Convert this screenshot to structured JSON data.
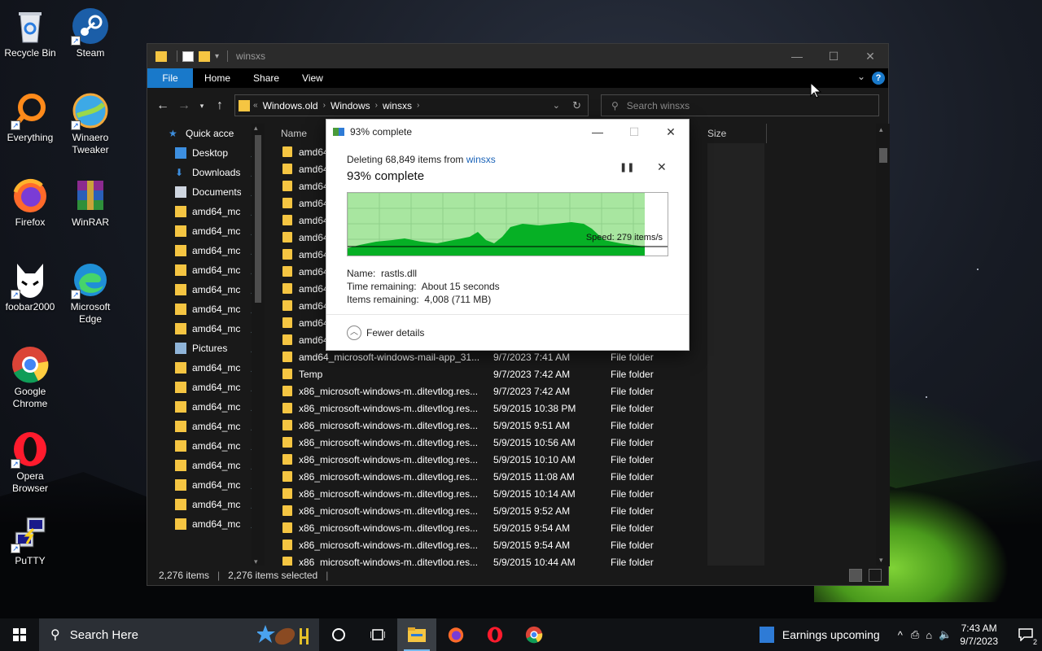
{
  "desktop": {
    "icons": [
      {
        "label": "Recycle Bin"
      },
      {
        "label": "Steam"
      },
      {
        "label": "Everything"
      },
      {
        "label": "Winaero Tweaker"
      },
      {
        "label": "Firefox"
      },
      {
        "label": "WinRAR"
      },
      {
        "label": "foobar2000"
      },
      {
        "label": "Microsoft Edge"
      },
      {
        "label": "Google Chrome"
      },
      {
        "label": "Opera Browser"
      },
      {
        "label": "PuTTY"
      }
    ]
  },
  "explorer": {
    "title": "winsxs",
    "ribbon_tabs": [
      "File",
      "Home",
      "Share",
      "View"
    ],
    "address": {
      "crumbs": [
        "Windows.old",
        "Windows",
        "winsxs"
      ]
    },
    "search_placeholder": "Search winsxs",
    "columns": {
      "name": "Name",
      "size": "Size"
    },
    "nav_items": [
      {
        "label": "Quick access",
        "pinned": false
      },
      {
        "label": "Desktop",
        "pinned": true
      },
      {
        "label": "Downloads",
        "pinned": true
      },
      {
        "label": "Documents",
        "pinned": true
      },
      {
        "label": "amd64_mc",
        "pinned": true
      },
      {
        "label": "amd64_mc",
        "pinned": true
      },
      {
        "label": "amd64_mc",
        "pinned": true
      },
      {
        "label": "amd64_mc",
        "pinned": true
      },
      {
        "label": "amd64_mc",
        "pinned": true
      },
      {
        "label": "amd64_mc",
        "pinned": true
      },
      {
        "label": "amd64_mc",
        "pinned": true
      },
      {
        "label": "Pictures",
        "pinned": true
      },
      {
        "label": "amd64_mc",
        "pinned": true
      },
      {
        "label": "amd64_mc",
        "pinned": true
      },
      {
        "label": "amd64_mc",
        "pinned": true
      },
      {
        "label": "amd64_mc",
        "pinned": true
      },
      {
        "label": "amd64_mc",
        "pinned": true
      },
      {
        "label": "amd64_mc",
        "pinned": true
      },
      {
        "label": "amd64_mc",
        "pinned": true
      },
      {
        "label": "amd64_mc",
        "pinned": true
      },
      {
        "label": "amd64_mc",
        "pinned": true
      }
    ],
    "rows": [
      {
        "name": "amd64",
        "date": "",
        "type": ""
      },
      {
        "name": "amd64",
        "date": "",
        "type": ""
      },
      {
        "name": "amd64",
        "date": "",
        "type": ""
      },
      {
        "name": "amd64",
        "date": "",
        "type": ""
      },
      {
        "name": "amd64",
        "date": "",
        "type": ""
      },
      {
        "name": "amd64",
        "date": "",
        "type": ""
      },
      {
        "name": "amd64",
        "date": "",
        "type": ""
      },
      {
        "name": "amd64",
        "date": "",
        "type": ""
      },
      {
        "name": "amd64",
        "date": "",
        "type": ""
      },
      {
        "name": "amd64",
        "date": "",
        "type": ""
      },
      {
        "name": "amd64",
        "date": "",
        "type": ""
      },
      {
        "name": "amd64",
        "date": "",
        "type": ""
      },
      {
        "name": "amd64_microsoft-windows-mail-app_31...",
        "date": "9/7/2023 7:41 AM",
        "type": "File folder"
      },
      {
        "name": "Temp",
        "date": "9/7/2023 7:42 AM",
        "type": "File folder"
      },
      {
        "name": "x86_microsoft-windows-m..ditevtlog.res...",
        "date": "9/7/2023 7:42 AM",
        "type": "File folder"
      },
      {
        "name": "x86_microsoft-windows-m..ditevtlog.res...",
        "date": "5/9/2015 10:38 PM",
        "type": "File folder"
      },
      {
        "name": "x86_microsoft-windows-m..ditevtlog.res...",
        "date": "5/9/2015 9:51 AM",
        "type": "File folder"
      },
      {
        "name": "x86_microsoft-windows-m..ditevtlog.res...",
        "date": "5/9/2015 10:56 AM",
        "type": "File folder"
      },
      {
        "name": "x86_microsoft-windows-m..ditevtlog.res...",
        "date": "5/9/2015 10:10 AM",
        "type": "File folder"
      },
      {
        "name": "x86_microsoft-windows-m..ditevtlog.res...",
        "date": "5/9/2015 11:08 AM",
        "type": "File folder"
      },
      {
        "name": "x86_microsoft-windows-m..ditevtlog.res...",
        "date": "5/9/2015 10:14 AM",
        "type": "File folder"
      },
      {
        "name": "x86_microsoft-windows-m..ditevtlog.res...",
        "date": "5/9/2015 9:52 AM",
        "type": "File folder"
      },
      {
        "name": "x86_microsoft-windows-m..ditevtlog.res...",
        "date": "5/9/2015 9:54 AM",
        "type": "File folder"
      },
      {
        "name": "x86_microsoft-windows-m..ditevtlog.res...",
        "date": "5/9/2015 9:54 AM",
        "type": "File folder"
      },
      {
        "name": "x86_microsoft-windows-m..ditevtlog.res...",
        "date": "5/9/2015 10:44 AM",
        "type": "File folder"
      }
    ],
    "status": {
      "items": "2,276 items",
      "selected": "2,276 items selected"
    }
  },
  "dialog": {
    "title": "93% complete",
    "deleting_prefix": "Deleting 68,849 items from",
    "deleting_link": "winsxs",
    "percent_text": "93% complete",
    "speed": "Speed: 279 items/s",
    "progress_fraction": 0.93,
    "details": {
      "name_label": "Name:",
      "name_value": "rastls.dll",
      "time_label": "Time remaining:",
      "time_value": "About 15 seconds",
      "items_label": "Items remaining:",
      "items_value": "4,008 (711 MB)"
    },
    "fewer_details": "Fewer details"
  },
  "taskbar": {
    "search_placeholder": "Search Here",
    "news": "Earnings upcoming",
    "time": "7:43 AM",
    "date": "9/7/2023",
    "notification_count": "2"
  },
  "colors": {
    "accent": "#1979ca",
    "graph_fill": "#06b025",
    "graph_bg": "#a8e6a0",
    "folder": "#f5c542"
  }
}
